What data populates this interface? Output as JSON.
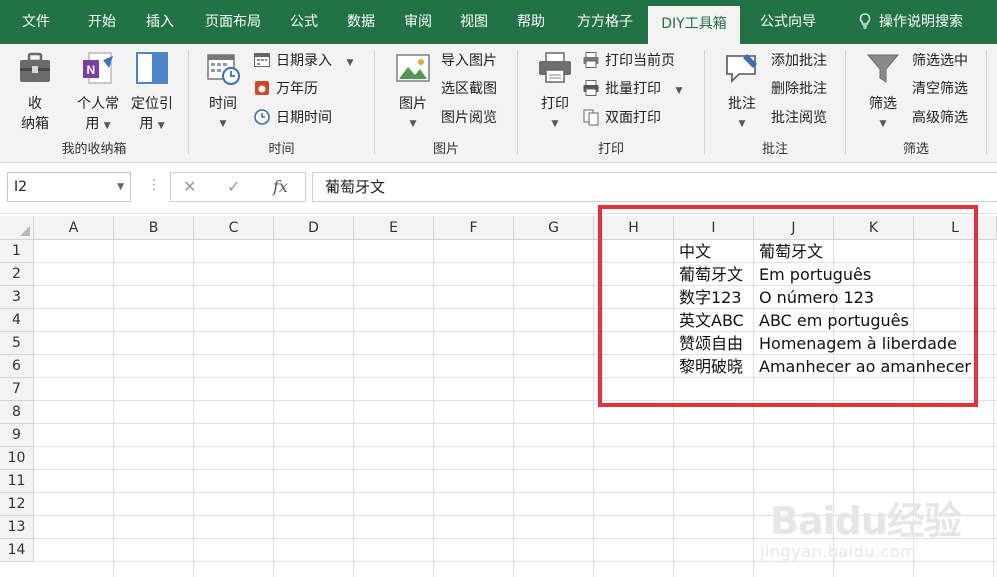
{
  "tabs": [
    {
      "label": "文件"
    },
    {
      "label": "开始"
    },
    {
      "label": "插入"
    },
    {
      "label": "页面布局"
    },
    {
      "label": "公式"
    },
    {
      "label": "数据"
    },
    {
      "label": "审阅"
    },
    {
      "label": "视图"
    },
    {
      "label": "帮助"
    },
    {
      "label": "方方格子"
    },
    {
      "label": "DIY工具箱",
      "active": true
    },
    {
      "label": "公式向导"
    },
    {
      "label": "操作说明搜索"
    }
  ],
  "ribbon": {
    "g1": {
      "label": "我的收纳箱",
      "b1a": "收",
      "b1b": "纳箱",
      "b2a": "个人常",
      "b2b": "用",
      "b3a": "定位引",
      "b3b": "用"
    },
    "g2": {
      "label": "时间",
      "big": "时间",
      "s1": "日期录入",
      "s2": "万年历",
      "s3": "日期时间"
    },
    "g3": {
      "label": "图片",
      "big": "图片",
      "s1": "导入图片",
      "s2": "选区截图",
      "s3": "图片阅览"
    },
    "g4": {
      "label": "打印",
      "big": "打印",
      "s1": "打印当前页",
      "s2": "批量打印",
      "s3": "双面打印"
    },
    "g5": {
      "label": "批注",
      "big": "批注",
      "s1": "添加批注",
      "s2": "删除批注",
      "s3": "批注阅览"
    },
    "g6": {
      "label": "筛选",
      "big": "筛选",
      "s1": "筛选选中",
      "s2": "清空筛选",
      "s3": "高级筛选"
    }
  },
  "formula_bar": {
    "name_box": "I2",
    "content": "葡萄牙文",
    "fx": "fx"
  },
  "sheet": {
    "columns": [
      "A",
      "B",
      "C",
      "D",
      "E",
      "F",
      "G",
      "H",
      "I",
      "J",
      "K",
      "L"
    ],
    "rows": [
      "1",
      "2",
      "3",
      "4",
      "5",
      "6",
      "7",
      "8",
      "9",
      "10",
      "11",
      "12",
      "13",
      "14"
    ],
    "cells": [
      {
        "ref": "I1",
        "text": "中文"
      },
      {
        "ref": "J1",
        "text": "葡萄牙文"
      },
      {
        "ref": "I2",
        "text": "葡萄牙文"
      },
      {
        "ref": "J2",
        "text": "Em português"
      },
      {
        "ref": "I3",
        "text": "数字123"
      },
      {
        "ref": "J3",
        "text": "O número 123"
      },
      {
        "ref": "I4",
        "text": "英文ABC"
      },
      {
        "ref": "J4",
        "text": "ABC em português"
      },
      {
        "ref": "I5",
        "text": "赞颂自由"
      },
      {
        "ref": "J5",
        "text": "Homenagem à liberdade"
      },
      {
        "ref": "I6",
        "text": "黎明破晓"
      },
      {
        "ref": "J6",
        "text": "Amanhecer ao amanhecer"
      }
    ]
  },
  "colors": {
    "ribbon_green": "#217346",
    "highlight_red": "#e8303a"
  },
  "watermark": {
    "line1": "Baidu经验",
    "line2": "jingyan.baidu.com"
  }
}
